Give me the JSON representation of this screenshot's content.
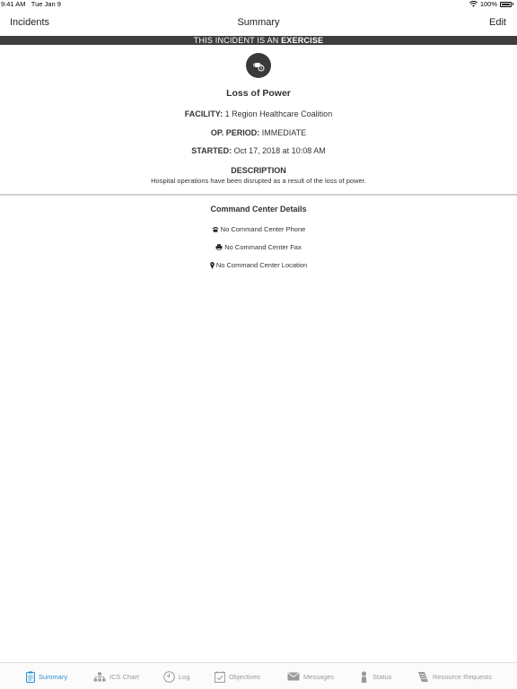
{
  "status_bar": {
    "time": "9:41 AM",
    "date": "Tue Jan 9",
    "battery": "100%",
    "icons": [
      "wifi-icon",
      "battery-icon"
    ]
  },
  "nav": {
    "back_label": "Incidents",
    "title": "Summary",
    "edit_label": "Edit"
  },
  "banner": {
    "prefix": "THIS INCIDENT IS AN ",
    "emphasis": "EXERCISE"
  },
  "incident": {
    "icon": "power-plug-icon",
    "title": "Loss of Power",
    "facility_label": "FACILITY:",
    "facility_value": "1 Region Healthcare Coalition",
    "op_period_label": "OP. PERIOD:",
    "op_period_value": "IMMEDIATE",
    "started_label": "STARTED:",
    "started_value": "Oct 17, 2018 at 10:08 AM",
    "description_label": "DESCRIPTION",
    "description_value": "Hospital operations have been disrupted as a result of the loss of power."
  },
  "command_center": {
    "title": "Command Center Details",
    "phone": "No Command Center Phone",
    "fax": "No Command Center Fax",
    "location": "No Command Center Location"
  },
  "tabs": [
    {
      "label": "Summary",
      "icon": "clipboard-icon",
      "active": true
    },
    {
      "label": "ICS Chart",
      "icon": "org-chart-icon",
      "active": false
    },
    {
      "label": "Log",
      "icon": "log-icon",
      "active": false
    },
    {
      "label": "Objectives",
      "icon": "checklist-icon",
      "active": false
    },
    {
      "label": "Messages",
      "icon": "envelope-icon",
      "active": false
    },
    {
      "label": "Status",
      "icon": "person-icon",
      "active": false
    },
    {
      "label": "Resource Requests",
      "icon": "resource-request-icon",
      "active": false
    }
  ],
  "colors": {
    "banner_bg": "#3e3e3e",
    "active_tab": "#2f8fd6",
    "inactive_tab": "#9a9a9a"
  }
}
